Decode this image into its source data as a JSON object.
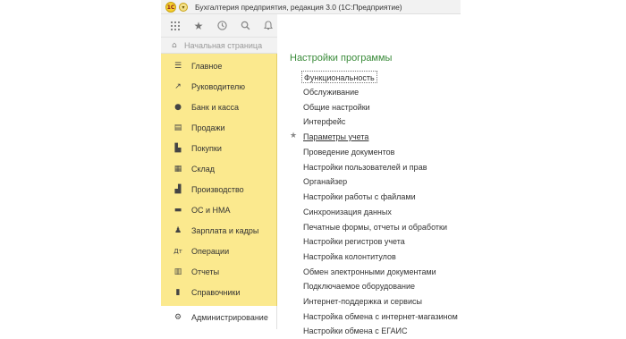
{
  "window": {
    "title": "Бухгалтерия предприятия, редакция 3.0 (1С:Предприятие)"
  },
  "toolbar": {
    "icons": [
      "grid-icon",
      "star-icon",
      "history-icon",
      "search-icon",
      "bell-icon"
    ]
  },
  "home": {
    "label": "Начальная страница"
  },
  "sidebar": {
    "items": [
      {
        "label": "Главное",
        "icon": "list-icon"
      },
      {
        "label": "Руководителю",
        "icon": "trend-icon"
      },
      {
        "label": "Банк и касса",
        "icon": "coin-icon"
      },
      {
        "label": "Продажи",
        "icon": "sales-icon"
      },
      {
        "label": "Покупки",
        "icon": "cart-icon"
      },
      {
        "label": "Склад",
        "icon": "warehouse-icon"
      },
      {
        "label": "Производство",
        "icon": "factory-icon"
      },
      {
        "label": "ОС и НМА",
        "icon": "truck-icon"
      },
      {
        "label": "Зарплата и кадры",
        "icon": "people-icon"
      },
      {
        "label": "Операции",
        "icon": "operations-icon"
      },
      {
        "label": "Отчеты",
        "icon": "chart-icon"
      },
      {
        "label": "Справочники",
        "icon": "book-icon"
      }
    ],
    "admin": {
      "label": "Администрирование",
      "icon": "gear-icon"
    }
  },
  "content": {
    "title": "Настройки программы",
    "links": [
      "Функциональность",
      "Обслуживание",
      "Общие настройки",
      "Интерфейс",
      "Параметры учета",
      "Проведение документов",
      "Настройки пользователей и прав",
      "Органайзер",
      "Настройки работы с файлами",
      "Синхронизация данных",
      "Печатные формы, отчеты и обработки",
      "Настройки регистров учета",
      "Настройка колонтитулов",
      "Обмен электронными документами",
      "Подключаемое оборудование",
      "Интернет-поддержка и сервисы",
      "Настройка обмена с интернет-магазином",
      "Настройки обмена с ЕГАИС"
    ]
  }
}
